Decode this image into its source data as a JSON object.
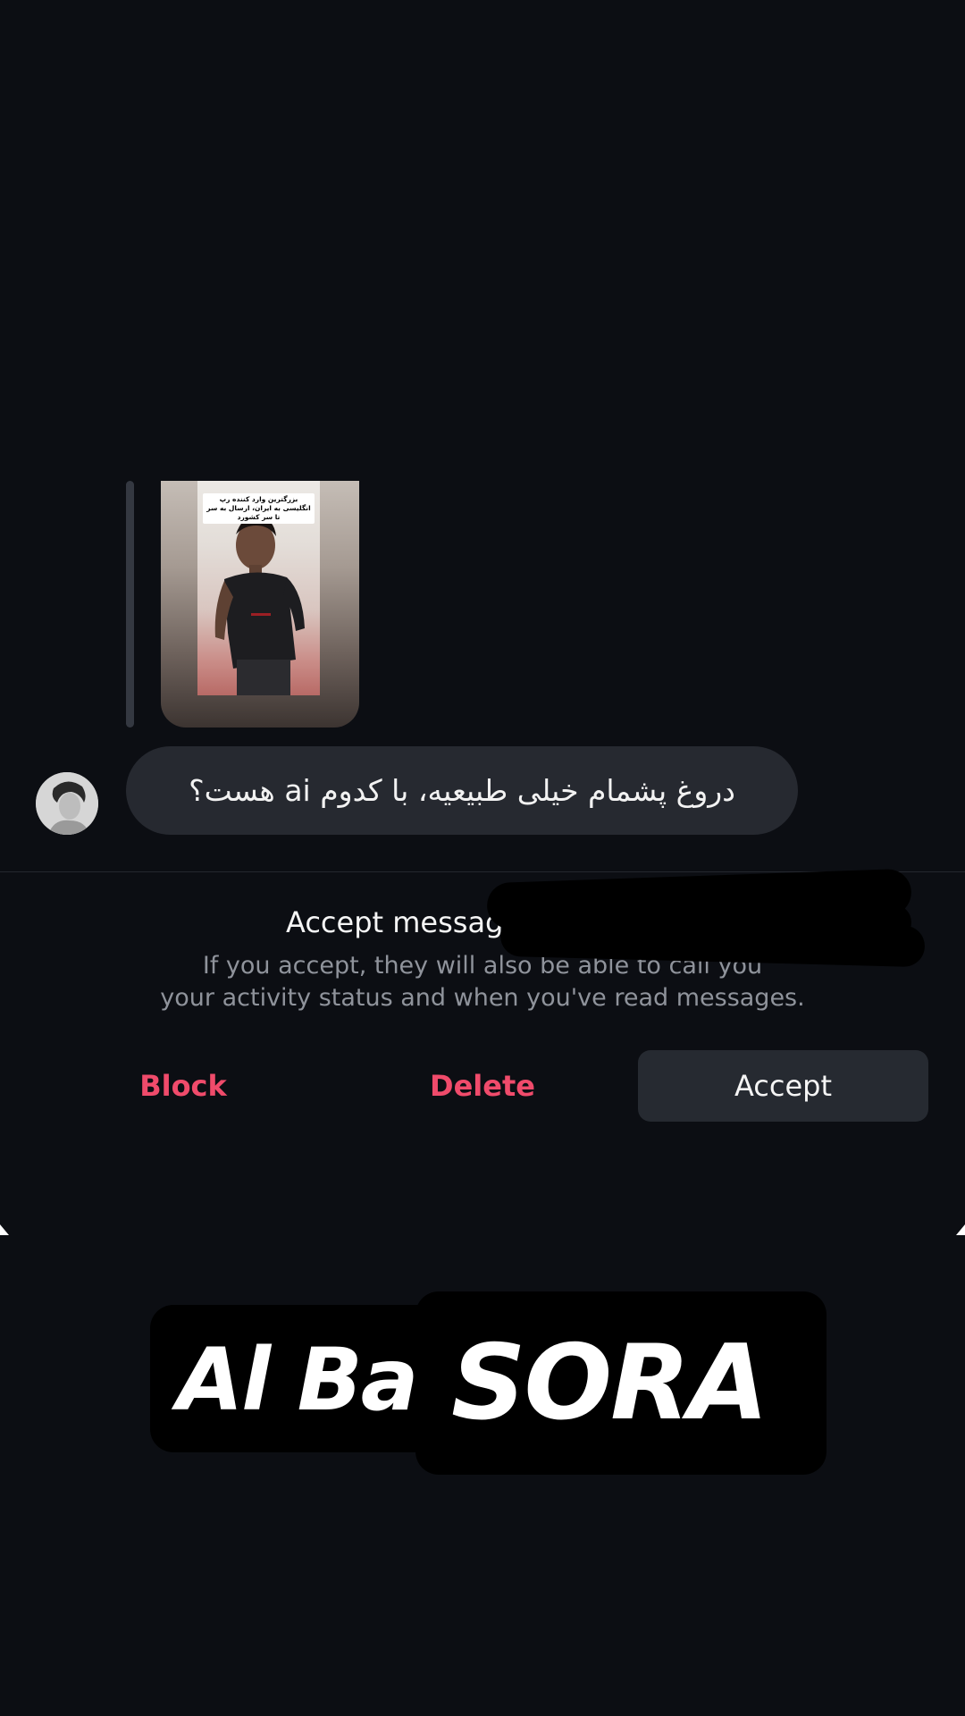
{
  "thread": {
    "shared_media": {
      "caption": "بزرگترین وارد کننده رپ انگلیسی به ایران، ارسال به سر تا سر کشورد",
      "label": "shared-reel"
    },
    "message": {
      "text": "دروغ پشمام خیلی طبیعیه، با کدوم ai هست؟"
    }
  },
  "request": {
    "title": "Accept message request fr",
    "description": "If you accept, they will also be able to call you and see your activity status and when you've read messages.",
    "desc_line1": "If you accept, they will also be able to call you",
    "desc_line2": "your activity status and when you've read messages."
  },
  "actions": {
    "block": "Block",
    "delete": "Delete",
    "accept": "Accept"
  },
  "overlay": {
    "left_text": "Al Ba",
    "right_text": "SORA"
  },
  "colors": {
    "background": "#0c0e13",
    "bubble": "#262930",
    "danger": "#f04b6b",
    "accept_button": "#262a31"
  }
}
